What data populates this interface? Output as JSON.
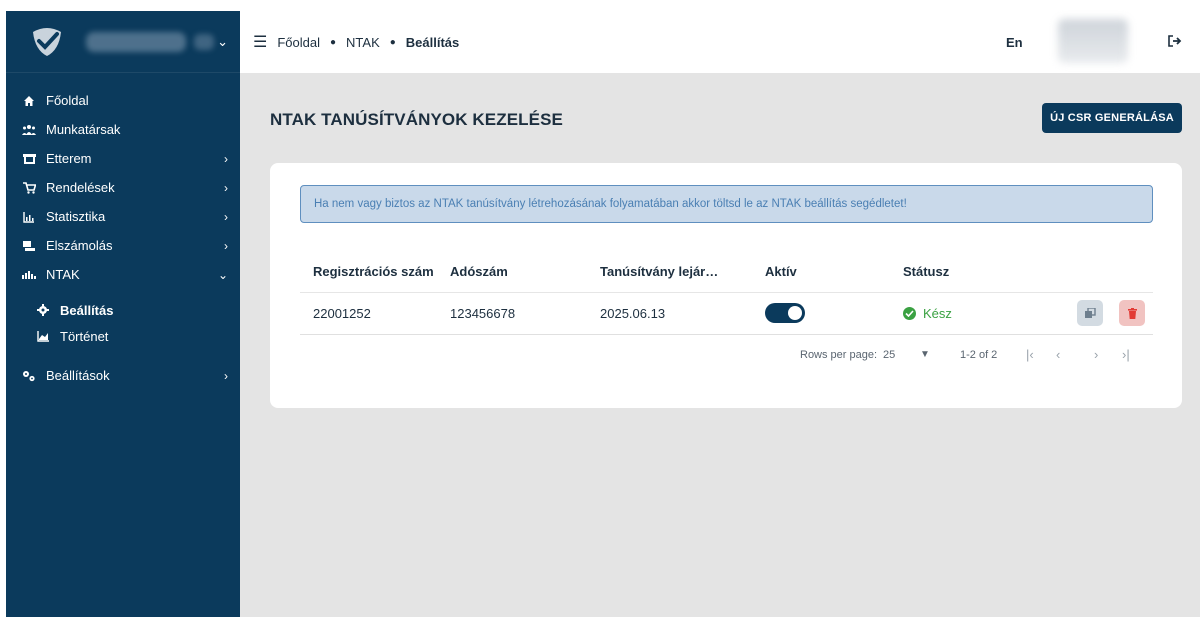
{
  "sidebar": {
    "items": [
      {
        "label": "Főoldal",
        "icon": "home-icon",
        "chevron": false
      },
      {
        "label": "Munkatársak",
        "icon": "users-icon",
        "chevron": false
      },
      {
        "label": "Etterem",
        "icon": "store-icon",
        "chevron": true
      },
      {
        "label": "Rendelések",
        "icon": "cart-icon",
        "chevron": true
      },
      {
        "label": "Statisztika",
        "icon": "chart-icon",
        "chevron": true
      },
      {
        "label": "Elszámolás",
        "icon": "register-icon",
        "chevron": true
      },
      {
        "label": "NTAK",
        "icon": "ntak-icon",
        "chevron": "down"
      }
    ],
    "sub_items": [
      {
        "label": "Beállítás",
        "icon": "gear-icon",
        "active": true
      },
      {
        "label": "Történet",
        "icon": "line-chart-icon",
        "active": false
      }
    ],
    "bottom_item": {
      "label": "Beállítások",
      "icon": "settings-icon"
    }
  },
  "topbar": {
    "breadcrumb": [
      "Főoldal",
      "NTAK",
      "Beállítás"
    ],
    "lang": "En"
  },
  "main": {
    "title": "NTAK TANÚSÍTVÁNYOK KEZELÉSE",
    "csr_button": "ÚJ CSR GENERÁLÁSA",
    "info": "Ha nem vagy biztos az NTAK tanúsítvány létrehozásának folyamatában akkor töltsd le az NTAK beállítás segédletet!",
    "table": {
      "headers": [
        "Regisztrációs szám",
        "Adószám",
        "Tanúsítvány lejár…",
        "Aktív",
        "Státusz"
      ],
      "rows": [
        {
          "reg": "22001252",
          "tax": "123456678",
          "expiry": "2025.06.13",
          "active": true,
          "status": "Kész"
        }
      ]
    },
    "pager": {
      "rows_label": "Rows per page:",
      "rows_value": "25",
      "range": "1-2 of 2"
    }
  },
  "colors": {
    "sidebar": "#0b3a5c",
    "accent": "#0b3a5c",
    "success": "#3aa142",
    "info_bg": "#c9d9ea",
    "danger_bg": "#f1c3c1"
  }
}
